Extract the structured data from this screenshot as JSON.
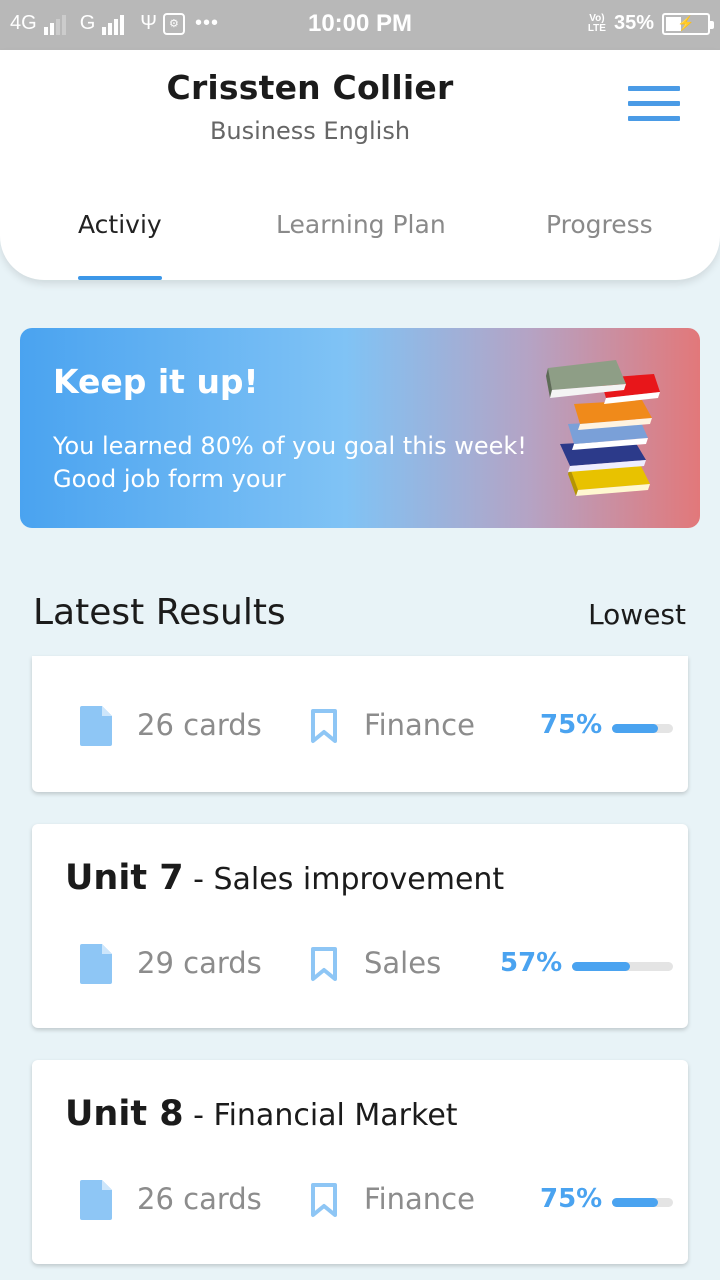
{
  "status_bar": {
    "network1": "4G",
    "network2": "G",
    "more": "•••",
    "time": "10:00 PM",
    "volte_top": "Vo)",
    "volte_bottom": "LTE",
    "battery": "35%"
  },
  "header": {
    "name": "Crissten Collier",
    "course": "Business English"
  },
  "tabs": [
    {
      "label": "Activiy",
      "active": true
    },
    {
      "label": "Learning Plan",
      "active": false
    },
    {
      "label": "Progress",
      "active": false
    }
  ],
  "banner": {
    "title": "Keep it up!",
    "line1": "You learned 80% of you goal this week!",
    "line2": "Good job form your"
  },
  "results": {
    "title": "Latest Results",
    "sort": "Lowest",
    "items": [
      {
        "unit": "",
        "name": "",
        "cards": "26 cards",
        "category": "Finance",
        "percent_label": "75%",
        "progress": 0.75
      },
      {
        "unit": "Unit 7",
        "name": " - Sales improvement",
        "cards": "29 cards",
        "category": "Sales",
        "percent_label": "57%",
        "progress": 0.57
      },
      {
        "unit": "Unit 8",
        "name": " - Financial Market",
        "cards": "26 cards",
        "category": "Finance",
        "percent_label": "75%",
        "progress": 0.75
      }
    ]
  },
  "colors": {
    "accent": "#4aa3f0",
    "icon": "#8ec6f5",
    "muted": "#8c8c8c"
  }
}
